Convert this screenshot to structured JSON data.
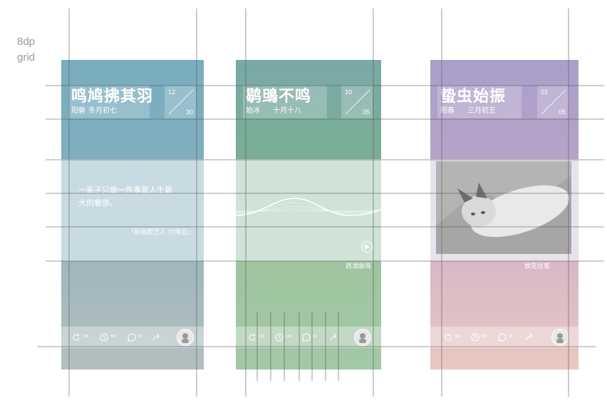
{
  "grid_label": "8dp\ngrid",
  "screens": [
    {
      "title": "鸣鸠拂其羽",
      "subtitle_a": "阳磐",
      "subtitle_b": "冬月初七",
      "month": "12",
      "day": "30",
      "quote": "一辈子只做一件事是人生最大的奢侈。",
      "quote_author": "「彩画塑艺人 付海云」",
      "counts": [
        "999",
        "999",
        "99"
      ]
    },
    {
      "title": "鹖鴠不鸣",
      "subtitle_a": "始冰",
      "subtitle_b": "十月十八",
      "month": "10",
      "day": "05",
      "caption": "西湖雷雨",
      "counts": [
        "999",
        "999",
        "99"
      ]
    },
    {
      "title": "蛰虫始振",
      "subtitle_a": "阳春",
      "subtitle_b": "三月初五",
      "month": "01",
      "day": "05",
      "caption": "故宫往客",
      "counts": [
        "999",
        "999",
        "99"
      ]
    }
  ],
  "colors": {
    "screen1_accent": "#78adbf",
    "screen2_accent": "#7bae94",
    "screen3_accent": "#aa9fca",
    "grid_line": "#555555"
  },
  "icons": [
    "refresh-icon",
    "clock-icon",
    "comment-icon",
    "share-icon",
    "avatar-icon",
    "play-icon"
  ]
}
